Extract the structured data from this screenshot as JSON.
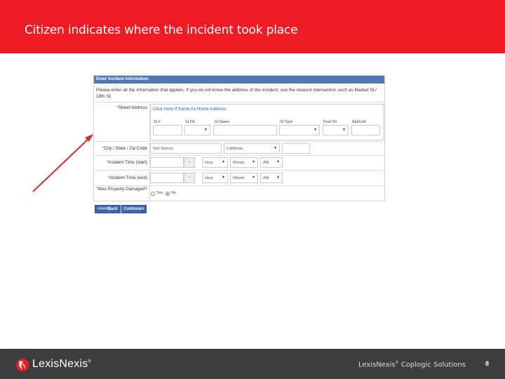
{
  "slide": {
    "title": "Citizen indicates where the incident took place",
    "title_bar_color": "#ed1c24",
    "page_number": "8"
  },
  "form": {
    "header": "Enter Incident Information",
    "intro": "Please enter all the information that applies. If you do not know the address of the incident, use the nearest intersection such as Market St./ 19th St.",
    "street_address": {
      "label": "Street Address",
      "link_text": "Click Here If Same As Home Address",
      "fields": [
        {
          "label": "St #",
          "value": ""
        },
        {
          "label": "St Dir",
          "value": ""
        },
        {
          "label": "St Name",
          "value": ""
        },
        {
          "label": "St Type",
          "value": ""
        },
        {
          "label": "Post Dir",
          "value": ""
        },
        {
          "label": "Apt/Unit",
          "value": ""
        }
      ]
    },
    "city_state_zip": {
      "label": "City / State / Zip Code",
      "city": "San Ramon",
      "state": "California",
      "zip": ""
    },
    "incident_start": {
      "label": "Incident Time (start)",
      "date_button": "...",
      "hour": "Hour",
      "minute": "Minute",
      "ampm": "AM"
    },
    "incident_end": {
      "label": "Incident Time (end)",
      "date_button": "...",
      "hour": "Hour",
      "minute": "Minute",
      "ampm": "AM"
    },
    "property_damaged": {
      "label": "Was Property Damaged?",
      "options": [
        "Yes",
        "No"
      ],
      "selected": "No"
    },
    "buttons": {
      "back": "<<<<Back",
      "continue": "Continue>"
    },
    "accent_color": "#4f77b8"
  },
  "footer": {
    "brand": "LexisNexis",
    "company": "LexisNexis",
    "company_suffix": " Coplogic Solutions",
    "background": "#3d3d3d"
  },
  "annotation": {
    "arrow_color": "#e0252b"
  }
}
